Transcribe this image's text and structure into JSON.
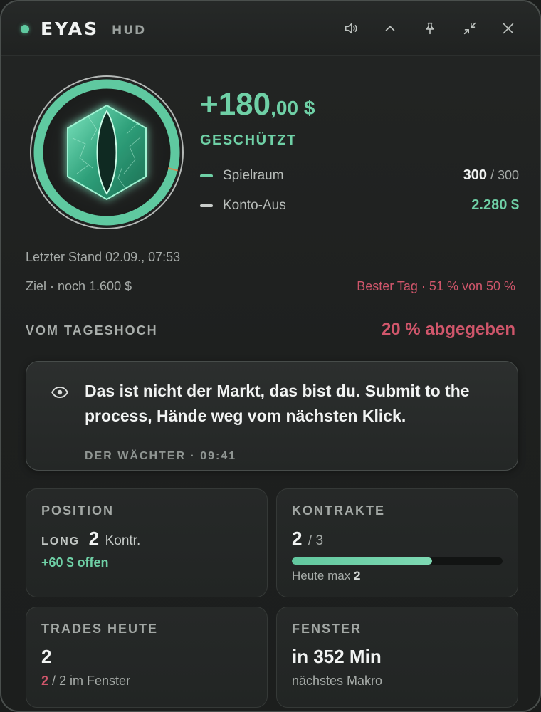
{
  "app": {
    "name": "EYAS",
    "sub": "HUD"
  },
  "titlebar": {
    "icons": [
      "speaker-icon",
      "chevron-up-icon",
      "pin-icon",
      "collapse-icon",
      "close-icon"
    ]
  },
  "hero": {
    "pnl_main": "+180",
    "pnl_cents": ",00 $",
    "status": "GESCHÜTZT",
    "ring_progress": 0.29,
    "rows": [
      {
        "label": "Spielraum",
        "value": "300",
        "value_suffix": " / 300",
        "color": "#6fd0a6"
      },
      {
        "label": "Konto-Aus",
        "value": "2.280 $",
        "color": "#c9cdca"
      }
    ]
  },
  "info": {
    "last_update": "Letzter Stand 02.09., 07:53",
    "goal": "Ziel · noch 1.600 $",
    "best_day": "Bester Tag · 51 % von 50 %"
  },
  "drawdown": {
    "label": "VOM TAGESHOCH",
    "value": "20 % abgegeben"
  },
  "quote": {
    "text": "Das ist nicht der Markt, das bist du. Submit to the process, Hände weg vom nächsten Klick.",
    "attribution": "DER WÄCHTER · 09:41"
  },
  "cards": {
    "position": {
      "title": "POSITION",
      "side": "LONG",
      "count": "2",
      "unit": "Kontr.",
      "open": "+60 $ offen"
    },
    "contracts": {
      "title": "KONTRAKTE",
      "value": "2",
      "max": "/ 3",
      "fraction": 0.667,
      "note_prefix": "Heute max",
      "note_value": "2"
    },
    "trades": {
      "title": "TRADES HEUTE",
      "value": "2",
      "note_red": "2",
      "note_rest": "/ 2 im Fenster"
    },
    "window": {
      "title": "FENSTER",
      "value": "in 352 Min",
      "note": "nächstes Makro"
    }
  },
  "colors": {
    "accent_green": "#6fd0a6",
    "accent_red": "#d0566b"
  }
}
